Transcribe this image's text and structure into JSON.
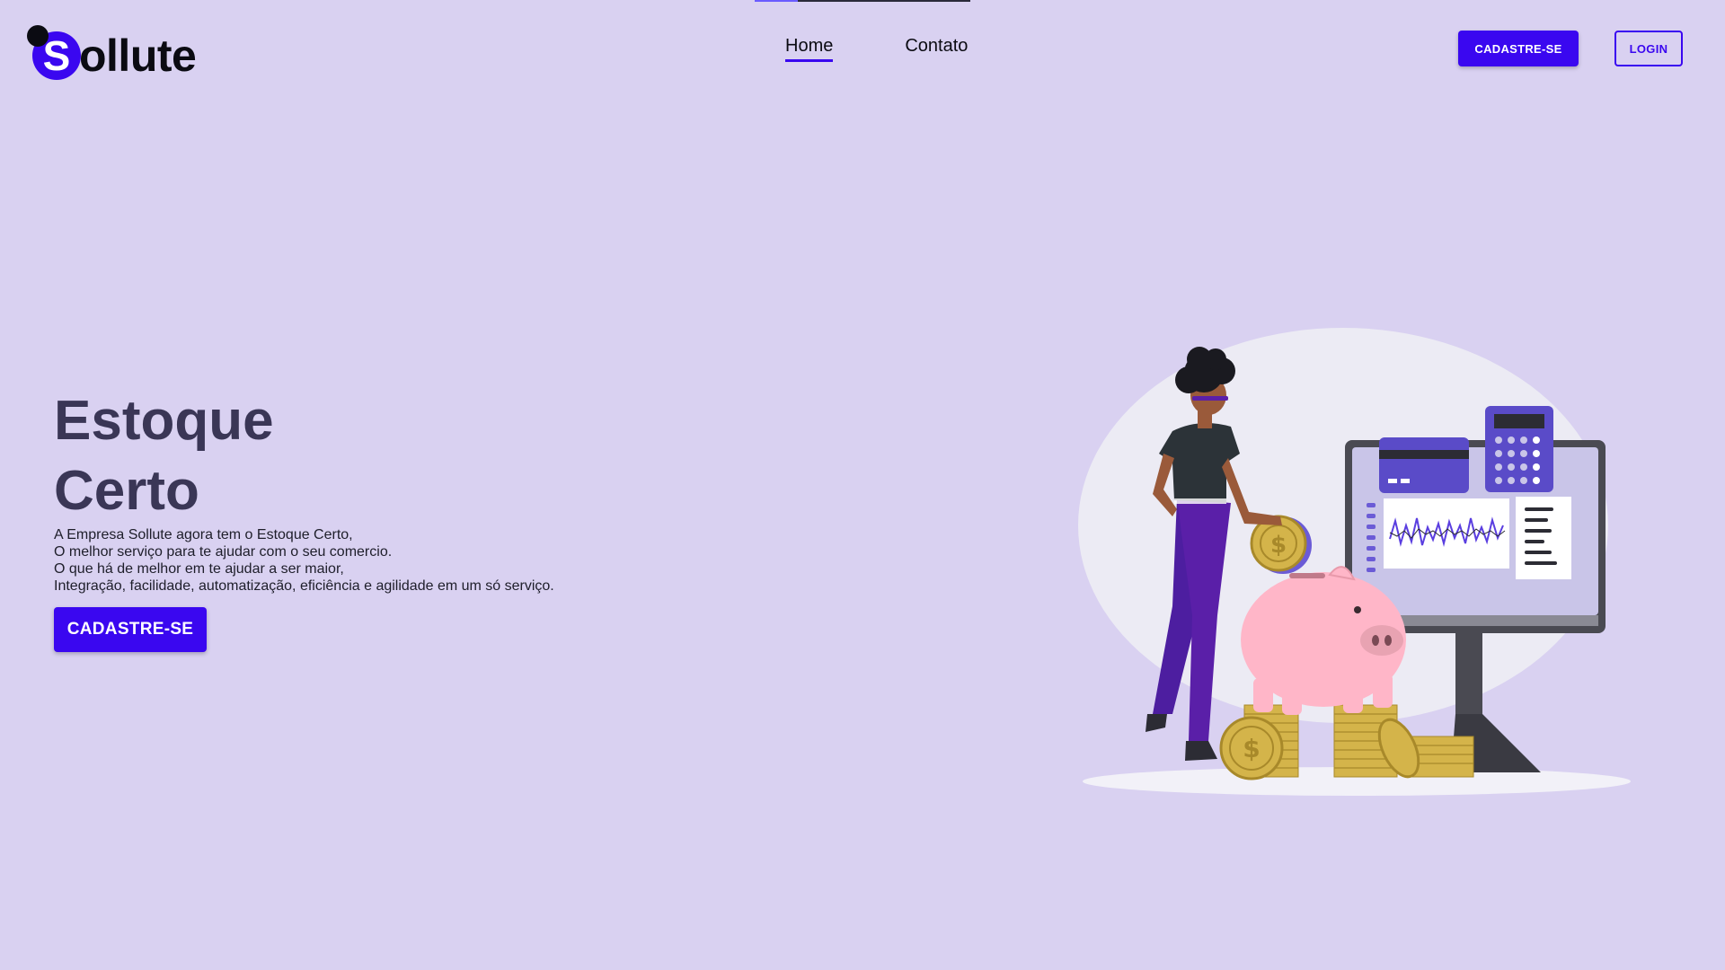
{
  "header": {
    "logo_letter": "S",
    "logo_text": "ollute",
    "nav": [
      {
        "label": "Home",
        "active": true
      },
      {
        "label": "Contato",
        "active": false
      }
    ],
    "signup_label": "CADASTRE-SE",
    "login_label": "LOGIN"
  },
  "hero": {
    "title_line1": "Estoque",
    "title_line2": "Certo",
    "description": [
      "A Empresa Sollute agora tem o Estoque Certo,",
      "O melhor serviço para te ajudar com o seu comercio.",
      "O que há de melhor em te ajudar a ser maior,",
      "Integração, facilidade, automatização, eficiência e agilidade em um só serviço."
    ],
    "cta_label": "CADASTRE-SE"
  },
  "colors": {
    "background": "#d9d1f1",
    "primary": "#3a07f0",
    "title": "#3a3656"
  }
}
